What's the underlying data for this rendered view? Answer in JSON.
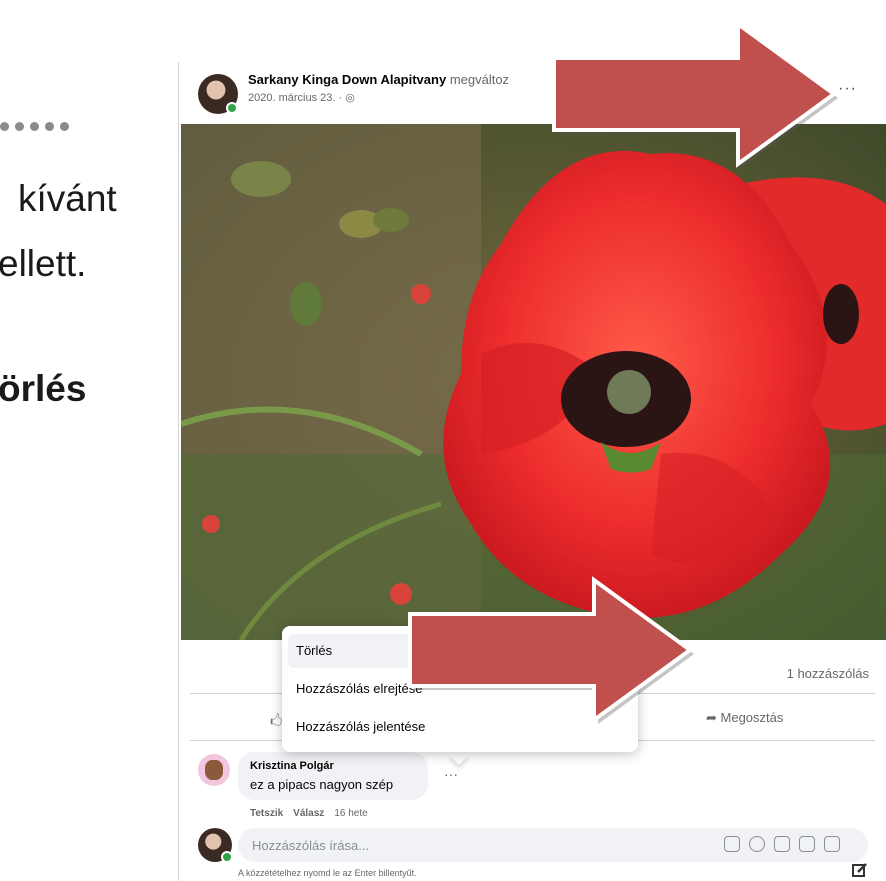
{
  "slide": {
    "line1": "kívánt",
    "line2": "ellett.",
    "line3": "örlés"
  },
  "post": {
    "author_name": "Sarkany Kinga Down Alapitvany",
    "author_action": "megváltoz",
    "date": "2020. március 23. · ",
    "more_label": "···",
    "comments_count": "1 hozzászólás",
    "share_label": "Megosztás"
  },
  "menu": {
    "items": [
      "Törlés",
      "Hozzászólás elrejtése",
      "Hozzászólás jelentése"
    ]
  },
  "comment": {
    "author": "Krisztina Polgár",
    "text": "ez a pipacs nagyon szép",
    "like": "Tetszik",
    "reply": "Válasz",
    "age": "16 hete",
    "more_label": "···"
  },
  "composer": {
    "placeholder": "Hozzászólás írása...",
    "hint": "A közzétételhez nyomd le az Enter billentyűt."
  },
  "colors": {
    "arrow": "#c0504d",
    "poppy": "#e8252a",
    "online": "#31a24c"
  }
}
